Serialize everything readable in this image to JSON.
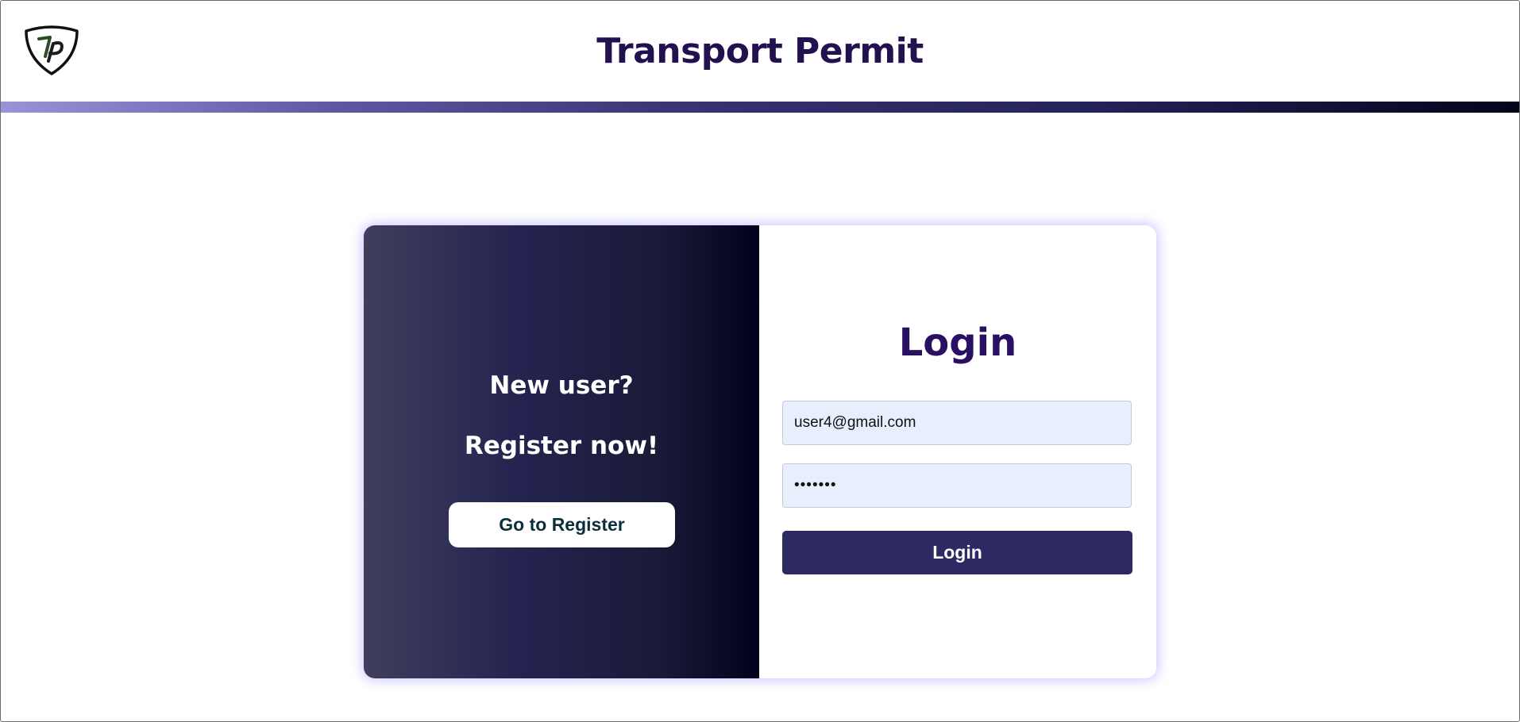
{
  "header": {
    "title": "Transport Permit",
    "logo_icon": "tp-shield-logo-icon"
  },
  "register_panel": {
    "line1": "New user?",
    "line2": "Register now!",
    "button_label": "Go to Register"
  },
  "login_panel": {
    "title": "Login",
    "email": {
      "value": "user4@gmail.com"
    },
    "password": {
      "value": "•••••••"
    },
    "button_label": "Login"
  },
  "colors": {
    "title": "#22104f",
    "login_button": "#2d2a63",
    "panel_dark": "#02011d",
    "field_bg": "#e8effc"
  }
}
